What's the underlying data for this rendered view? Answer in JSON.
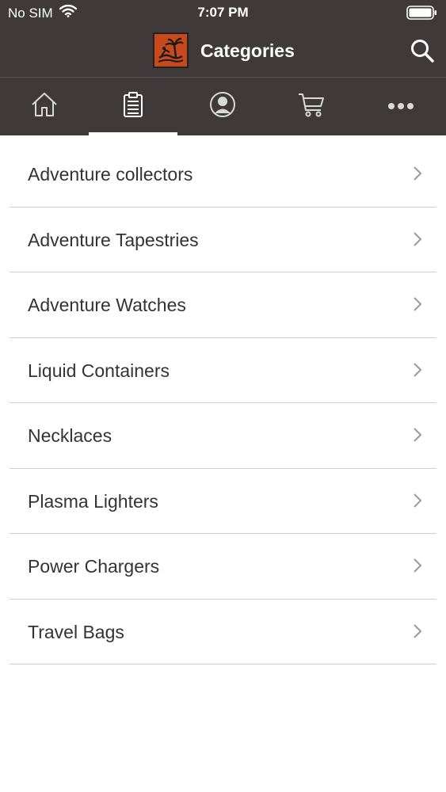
{
  "status_bar": {
    "carrier": "No SIM",
    "time": "7:07 PM"
  },
  "header": {
    "title": "Categories"
  },
  "tabs": [
    {
      "id": "home",
      "icon": "home-icon"
    },
    {
      "id": "orders",
      "icon": "clipboard-icon",
      "active": true
    },
    {
      "id": "account",
      "icon": "user-icon"
    },
    {
      "id": "cart",
      "icon": "cart-icon"
    },
    {
      "id": "more",
      "icon": "more-icon"
    }
  ],
  "categories": [
    {
      "label": "Adventure collectors"
    },
    {
      "label": "Adventure Tapestries"
    },
    {
      "label": "Adventure Watches"
    },
    {
      "label": "Liquid Containers"
    },
    {
      "label": "Necklaces"
    },
    {
      "label": "Plasma Lighters"
    },
    {
      "label": "Power Chargers"
    },
    {
      "label": "Travel Bags"
    }
  ],
  "colors": {
    "bar": "#3f3a39",
    "logo": "#c84a1c",
    "text": "#333333",
    "divider": "#cfcfcf"
  }
}
